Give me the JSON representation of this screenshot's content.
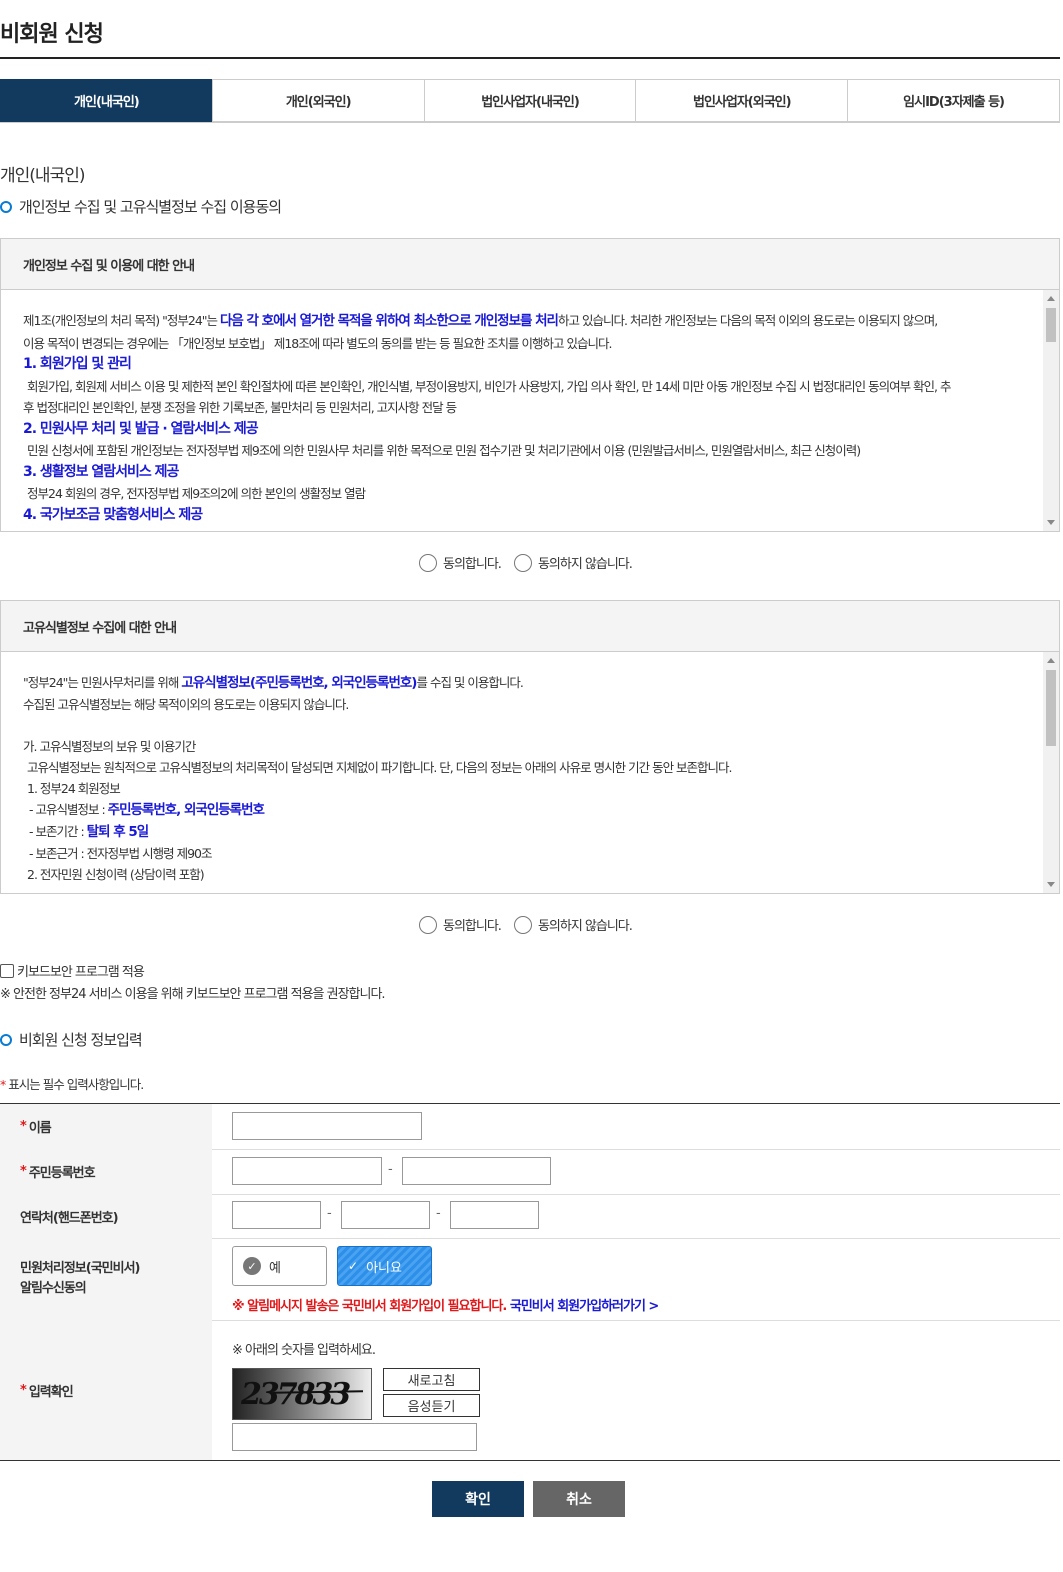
{
  "page_title": "비회원 신청",
  "tabs": [
    {
      "label": "개인(내국인)"
    },
    {
      "label": "개인(외국인)"
    },
    {
      "label": "법인사업자(내국인)"
    },
    {
      "label": "법인사업자(외국인)"
    },
    {
      "label": "임시ID(3자제출 등)"
    }
  ],
  "section_name": "개인(내국인)",
  "consent_title": "개인정보 수집 및 고유식별정보 수집 이용동의",
  "box1": {
    "heading": "개인정보 수집 및 이용에 대한 안내",
    "p1a": "제1조(개인정보의 처리 목적) \"정부24\"는 ",
    "p1b": "다음 각 호에서 열거한 목적을 위하여 최소한으로 개인정보를 처리",
    "p1c": "하고 있습니다. 처리한 개인정보는 다음의 목적 이외의 용도로는 이용되지 않으며,",
    "p1d": "이용 목적이 변경되는 경우에는 「개인정보 보호법」 제18조에 따라 별도의 동의를 받는 등 필요한 조치를 이행하고 있습니다.",
    "h1": "1. 회원가입 및 관리",
    "t1a": "회원가입, 회원제 서비스 이용 및 제한적 본인 확인절차에 따른 본인확인, 개인식별, 부정이용방지, 비인가 사용방지, 가입 의사 확인, 만 14세 미만 아동 개인정보 수집 시 법정대리인 동의여부 확인, 추",
    "t1b": "후 법정대리인 본인확인, 분쟁 조정을 위한 기록보존, 불만처리 등 민원처리, 고지사항 전달 등",
    "h2": "2. 민원사무 처리 및 발급 · 열람서비스 제공",
    "t2": "민원 신청서에 포함된 개인정보는 전자정부법 제9조에 의한 민원사무 처리를 위한 목적으로 민원 접수기관 및 처리기관에서 이용 (민원발급서비스, 민원열람서비스, 최근 신청이력)",
    "h3": "3. 생활정보 열람서비스 제공",
    "t3": "정부24 회원의 경우, 전자정부법 제9조의2에 의한 본인의 생활정보 열람",
    "h4": "4. 국가보조금 맞춤형서비스 제공"
  },
  "agree_label": "동의합니다.",
  "disagree_label": "동의하지 않습니다.",
  "box2": {
    "heading": "고유식별정보 수집에 대한 안내",
    "p1a": "\"정부24\"는 민원사무처리를 위해 ",
    "p1b": "고유식별정보(주민등록번호, 외국인등록번호)",
    "p1c": "를 수집 및 이용합니다.",
    "p2": "수집된 고유식별정보는 해당 목적이외의 용도로는 이용되지 않습니다.",
    "ga": "가. 고유식별정보의 보유 및 이용기간",
    "ga_t": "고유식별정보는 원칙적으로 고유식별정보의 처리목적이 달성되면 지체없이 파기합니다. 단, 다음의 정보는 아래의 사유로 명시한 기간 동안 보존합니다.",
    "i1": "1. 정부24 회원정보",
    "i1a": "- 고유식별정보 : ",
    "i1a_v": "주민등록번호, 외국인등록번호",
    "i1b": "- 보존기간 : ",
    "i1b_v": "탈퇴 후 5일",
    "i1c": "- 보존근거 : 전자정부법 시행령 제90조",
    "i2": "2. 전자민원 신청이력 (상담이력 포함)"
  },
  "keyboard": {
    "label": "키보드보안 프로그램 적용",
    "note": "※ 안전한 정부24 서비스 이용을 위해 키보드보안 프로그램 적용을 권장합니다."
  },
  "form_title": "비회원 신청 정보입력",
  "required_note": "표시는 필수 입력사항입니다.",
  "required_mark": "*",
  "fields": {
    "name": "이름",
    "rrn": "주민등록번호",
    "phone": "연락처(핸드폰번호)",
    "notice_line1": "민원처리정보(국민비서)",
    "notice_line2": "알림수신동의",
    "captcha": "입력확인"
  },
  "dash": "-",
  "notice": {
    "yes": "예",
    "no": "아니요",
    "warning": "※ 알림메시지 발송은 국민비서 회원가입이 필요합니다.",
    "link": "국민비서 회원가입하러가기 >"
  },
  "captcha": {
    "instruction": "※ 아래의 숫자를 입력하세요.",
    "code": "237833",
    "refresh": "새로고침",
    "audio": "음성듣기"
  },
  "buttons": {
    "confirm": "확인",
    "cancel": "취소"
  },
  "colors": {
    "active_tab": "#123a5e",
    "confirm": "#123a5e",
    "cancel": "#666666",
    "accent_blue": "#1a1ad6",
    "required_red": "#e0181a"
  }
}
